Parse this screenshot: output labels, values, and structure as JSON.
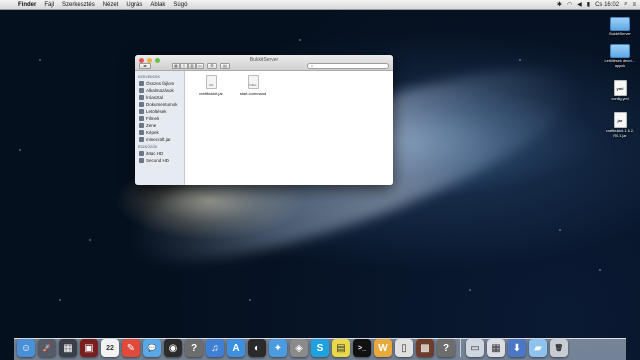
{
  "menubar": {
    "app_name": "Finder",
    "items": [
      "Fájl",
      "Szerkesztés",
      "Nézet",
      "Ugrás",
      "Ablak",
      "Súgó"
    ],
    "clock": "Cs 16:02"
  },
  "window": {
    "title": "BukkitServer",
    "sidebar": {
      "favorites_header": "KEDVENCEK",
      "favorites": [
        "Összes fájlom",
        "Alkalmazások",
        "Íróasztal",
        "Dokumentumok",
        "Letöltések",
        "Filmek",
        "Zene",
        "Képek",
        "minecraft.jar"
      ],
      "devices_header": "ESZKÖZÖK",
      "devices": [
        "iMac HD",
        "Second HD"
      ]
    },
    "files": [
      {
        "name": "craftbukkit.jar",
        "ext": "JAR"
      },
      {
        "name": "start.command",
        "ext": "SHELL"
      }
    ]
  },
  "desktop": {
    "icons": [
      {
        "label": "BukkitServer",
        "kind": "folder"
      },
      {
        "label": "Letöltések dexvi…appok",
        "kind": "folder"
      },
      {
        "label": "config.yml",
        "kind": "doc",
        "badge": "yml"
      },
      {
        "label": "craftbukkit-1.6.2-R0.1.jar",
        "kind": "doc",
        "badge": "jar"
      }
    ]
  },
  "dock": {
    "icons": [
      {
        "name": "finder-icon",
        "color": "#4a90d9",
        "glyph": "☺"
      },
      {
        "name": "launchpad-icon",
        "color": "#555b66",
        "glyph": "🚀"
      },
      {
        "name": "mission-control-icon",
        "color": "#3a3f47",
        "glyph": "▦"
      },
      {
        "name": "photo-booth-icon",
        "color": "#7a1f1f",
        "glyph": "▣"
      },
      {
        "name": "calendar-icon",
        "color": "#f2f2f2",
        "glyph": "22"
      },
      {
        "name": "notes-icon",
        "color": "#e04a3a",
        "glyph": "✎"
      },
      {
        "name": "messages-icon",
        "color": "#5aa9e6",
        "glyph": "💬"
      },
      {
        "name": "facetime-icon",
        "color": "#2b2b2b",
        "glyph": "◉"
      },
      {
        "name": "help-icon",
        "color": "#6d6d6d",
        "glyph": "?"
      },
      {
        "name": "itunes-icon",
        "color": "#3f7fd6",
        "glyph": "♫"
      },
      {
        "name": "app-store-icon",
        "color": "#3d8fe0",
        "glyph": "A"
      },
      {
        "name": "steam-icon",
        "color": "#2a2a2a",
        "glyph": "◐"
      },
      {
        "name": "safari-icon",
        "color": "#4a9be0",
        "glyph": "✦"
      },
      {
        "name": "preview-icon",
        "color": "#8a8a8a",
        "glyph": "◈"
      },
      {
        "name": "skype-icon",
        "color": "#1fa3e0",
        "glyph": "S"
      },
      {
        "name": "stickies-icon",
        "color": "#e8d94a",
        "glyph": "▤"
      },
      {
        "name": "terminal-icon",
        "color": "#111111",
        "glyph": ">_"
      },
      {
        "name": "gdevelop-icon",
        "color": "#e8a93a",
        "glyph": "W"
      },
      {
        "name": "document-icon",
        "color": "#e0e0e0",
        "glyph": "▯"
      },
      {
        "name": "minecraft-icon",
        "color": "#6b3d2a",
        "glyph": "▩"
      },
      {
        "name": "question-icon",
        "color": "#6d6d6d",
        "glyph": "?"
      },
      {
        "name": "window-icon",
        "color": "#cfd6df",
        "glyph": "▭"
      },
      {
        "name": "grid-icon",
        "color": "#d9dde3",
        "glyph": "▦"
      },
      {
        "name": "downloads-stack-icon",
        "color": "#4a78c4",
        "glyph": "⬇"
      },
      {
        "name": "folder-stack-icon",
        "color": "#8fc3ef",
        "glyph": "▰"
      },
      {
        "name": "trash-icon",
        "color": "#c8cdd4",
        "glyph": "🗑"
      }
    ]
  }
}
